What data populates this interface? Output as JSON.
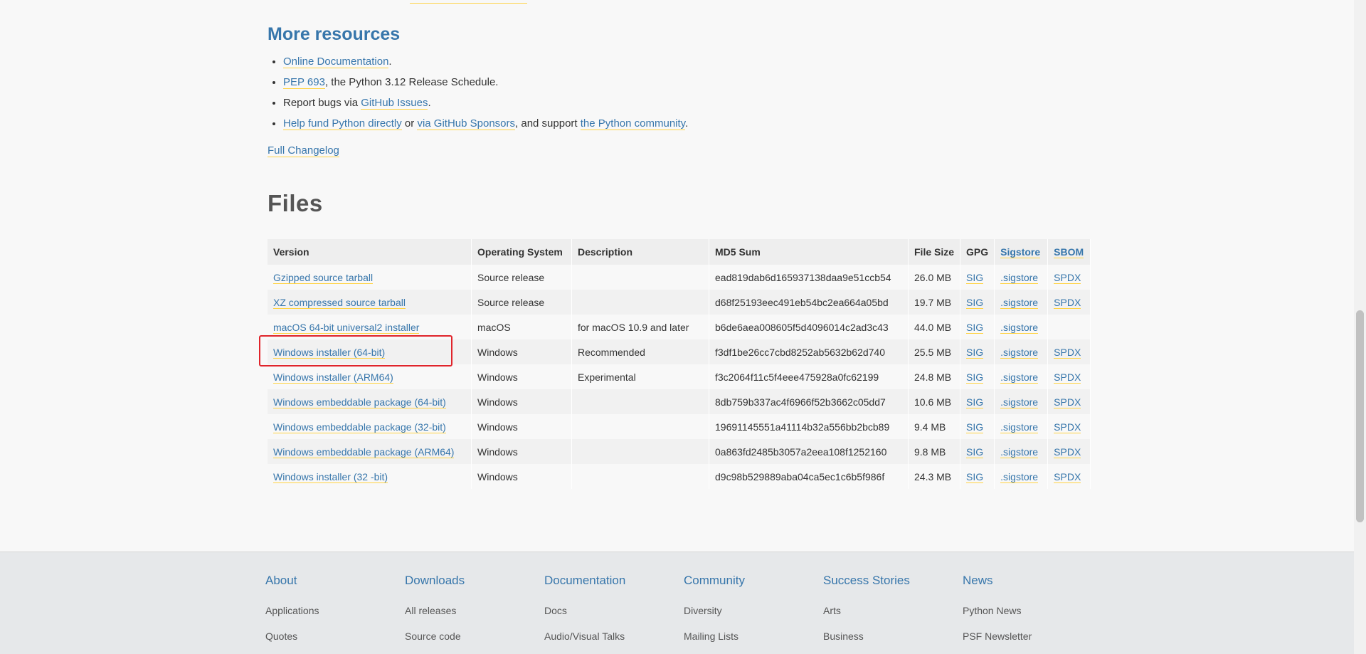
{
  "more_resources": {
    "title": "More resources",
    "items": [
      {
        "link1": "Online Documentation",
        "text1": "."
      },
      {
        "link1": "PEP 693",
        "text1": ", the Python 3.12 Release Schedule."
      },
      {
        "text0": "Report bugs via ",
        "link1": "GitHub Issues",
        "text1": "."
      },
      {
        "link1": "Help fund Python directly",
        "text1": " or ",
        "link2": "via GitHub Sponsors",
        "text2": ", and support ",
        "link3": "the Python community",
        "text3": "."
      }
    ],
    "full_changelog": "Full Changelog"
  },
  "files": {
    "title": "Files",
    "headers": {
      "version": "Version",
      "os": "Operating System",
      "description": "Description",
      "md5": "MD5 Sum",
      "size": "File Size",
      "gpg": "GPG",
      "sigstore": "Sigstore",
      "sbom": "SBOM"
    },
    "rows": [
      {
        "version": "Gzipped source tarball",
        "os": "Source release",
        "description": "",
        "md5": "ead819dab6d165937138daa9e51ccb54",
        "size": "26.0 MB",
        "gpg": "SIG",
        "sigstore": ".sigstore",
        "sbom": "SPDX"
      },
      {
        "version": "XZ compressed source tarball",
        "os": "Source release",
        "description": "",
        "md5": "d68f25193eec491eb54bc2ea664a05bd",
        "size": "19.7 MB",
        "gpg": "SIG",
        "sigstore": ".sigstore",
        "sbom": "SPDX"
      },
      {
        "version": "macOS 64-bit universal2 installer",
        "os": "macOS",
        "description": "for macOS 10.9 and later",
        "md5": "b6de6aea008605f5d4096014c2ad3c43",
        "size": "44.0 MB",
        "gpg": "SIG",
        "sigstore": ".sigstore",
        "sbom": ""
      },
      {
        "version": "Windows installer (64-bit)",
        "os": "Windows",
        "description": "Recommended",
        "md5": "f3df1be26cc7cbd8252ab5632b62d740",
        "size": "25.5 MB",
        "gpg": "SIG",
        "sigstore": ".sigstore",
        "sbom": "SPDX"
      },
      {
        "version": "Windows installer (ARM64)",
        "os": "Windows",
        "description": "Experimental",
        "md5": "f3c2064f11c5f4eee475928a0fc62199",
        "size": "24.8 MB",
        "gpg": "SIG",
        "sigstore": ".sigstore",
        "sbom": "SPDX"
      },
      {
        "version": "Windows embeddable package (64-bit)",
        "os": "Windows",
        "description": "",
        "md5": "8db759b337ac4f6966f52b3662c05dd7",
        "size": "10.6 MB",
        "gpg": "SIG",
        "sigstore": ".sigstore",
        "sbom": "SPDX"
      },
      {
        "version": "Windows embeddable package (32-bit)",
        "os": "Windows",
        "description": "",
        "md5": "19691145551a41114b32a556bb2bcb89",
        "size": "9.4 MB",
        "gpg": "SIG",
        "sigstore": ".sigstore",
        "sbom": "SPDX"
      },
      {
        "version": "Windows embeddable package (ARM64)",
        "os": "Windows",
        "description": "",
        "md5": "0a863fd2485b3057a2eea108f1252160",
        "size": "9.8 MB",
        "gpg": "SIG",
        "sigstore": ".sigstore",
        "sbom": "SPDX"
      },
      {
        "version": "Windows installer (32 -bit)",
        "os": "Windows",
        "description": "",
        "md5": "d9c98b529889aba04ca5ec1c6b5f986f",
        "size": "24.3 MB",
        "gpg": "SIG",
        "sigstore": ".sigstore",
        "sbom": "SPDX"
      }
    ],
    "highlight_color": "#e0242b"
  },
  "footer": {
    "columns": [
      {
        "title": "About",
        "items": [
          "Applications",
          "Quotes"
        ]
      },
      {
        "title": "Downloads",
        "items": [
          "All releases",
          "Source code"
        ]
      },
      {
        "title": "Documentation",
        "items": [
          "Docs",
          "Audio/Visual Talks"
        ]
      },
      {
        "title": "Community",
        "items": [
          "Diversity",
          "Mailing Lists"
        ]
      },
      {
        "title": "Success Stories",
        "items": [
          "Arts",
          "Business"
        ]
      },
      {
        "title": "News",
        "items": [
          "Python News",
          "PSF Newsletter"
        ]
      }
    ]
  },
  "colors": {
    "link": "#3776ab",
    "link_underline": "#ffd343",
    "footer_bg": "#e6e8ea"
  }
}
